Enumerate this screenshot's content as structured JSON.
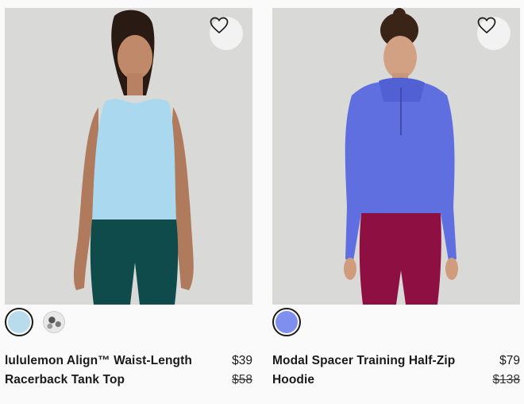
{
  "products": [
    {
      "name_line1": "lululemon Align™ Waist-Length",
      "name_line2": "Racerback Tank Top",
      "price": "$39",
      "original_price": "$58",
      "wishlist_icon": "heart-outline-icon",
      "swatches": [
        {
          "color": "#b8dcec",
          "selected": true
        },
        {
          "color": "camo-grey-white",
          "selected": false
        }
      ],
      "image": {
        "top_color": "#a9d8ef",
        "bottom_color": "#0e4b4a",
        "background": "#d8d8d6"
      }
    },
    {
      "name_line1": "Modal Spacer Training Half-Zip",
      "name_line2": "Hoodie",
      "price": "$79",
      "original_price": "$138",
      "wishlist_icon": "heart-outline-icon",
      "swatches": [
        {
          "color": "#7f8ff0",
          "selected": true
        }
      ],
      "image": {
        "top_color": "#5f6fe0",
        "bottom_color": "#8e1043",
        "background": "#d8d8d6"
      }
    }
  ]
}
